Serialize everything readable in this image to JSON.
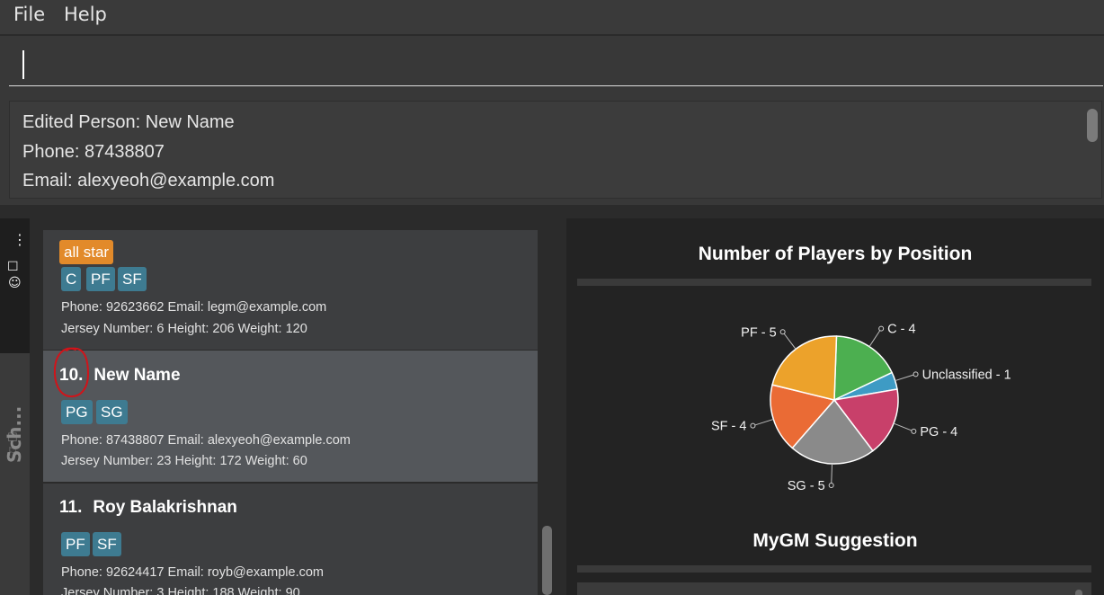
{
  "menu": {
    "file": "File",
    "help": "Help"
  },
  "command": {
    "value": ""
  },
  "result": {
    "lines": [
      "Edited Person: New Name",
      "Phone: 87438807",
      "Email: alexyeoh@example.com"
    ]
  },
  "sidebar": {
    "tab_label": "Sch..."
  },
  "persons": [
    {
      "index": "",
      "name": "",
      "tags": [
        {
          "label": "all star",
          "color": "#e28a2a"
        }
      ],
      "positions": [
        "C",
        "PF",
        "SF"
      ],
      "contact": "Phone: 92623662  Email: legm@example.com",
      "stats": "Jersey Number: 6  Height: 206  Weight: 120"
    },
    {
      "index": "10.",
      "name": "New Name",
      "positions": [
        "PG",
        "SG"
      ],
      "contact": "Phone: 87438807  Email: alexyeoh@example.com",
      "stats": "Jersey Number: 23  Height: 172  Weight: 60",
      "selected": true
    },
    {
      "index": "11.",
      "name": "Roy Balakrishnan",
      "positions": [
        "PF",
        "SF"
      ],
      "contact": "Phone: 92624417  Email: royb@example.com",
      "stats": "Jersey Number: 3  Height: 188  Weight: 90"
    }
  ],
  "colors": {
    "tag_blue": "#3e7b91",
    "tag_orange": "#e28a2a",
    "selected_card": "#54575b"
  },
  "chart_panel": {
    "title": "Number of Players by Position",
    "suggestion_title": "MyGM Suggestion"
  },
  "chart_data": {
    "type": "pie",
    "title": "Number of Players by Position",
    "slices": [
      {
        "label": "C - 4",
        "name": "C",
        "value": 4,
        "color": "#4caf50"
      },
      {
        "label": "Unclassified - 1",
        "name": "Unclassified",
        "value": 1,
        "color": "#3e9bc4"
      },
      {
        "label": "PG - 4",
        "name": "PG",
        "value": 4,
        "color": "#c8406a"
      },
      {
        "label": "SG - 5",
        "name": "SG",
        "value": 5,
        "color": "#8a8a8a"
      },
      {
        "label": "SF - 4",
        "name": "SF",
        "value": 4,
        "color": "#ea6b35"
      },
      {
        "label": "PF - 5",
        "name": "PF",
        "value": 5,
        "color": "#eca22b"
      }
    ]
  }
}
